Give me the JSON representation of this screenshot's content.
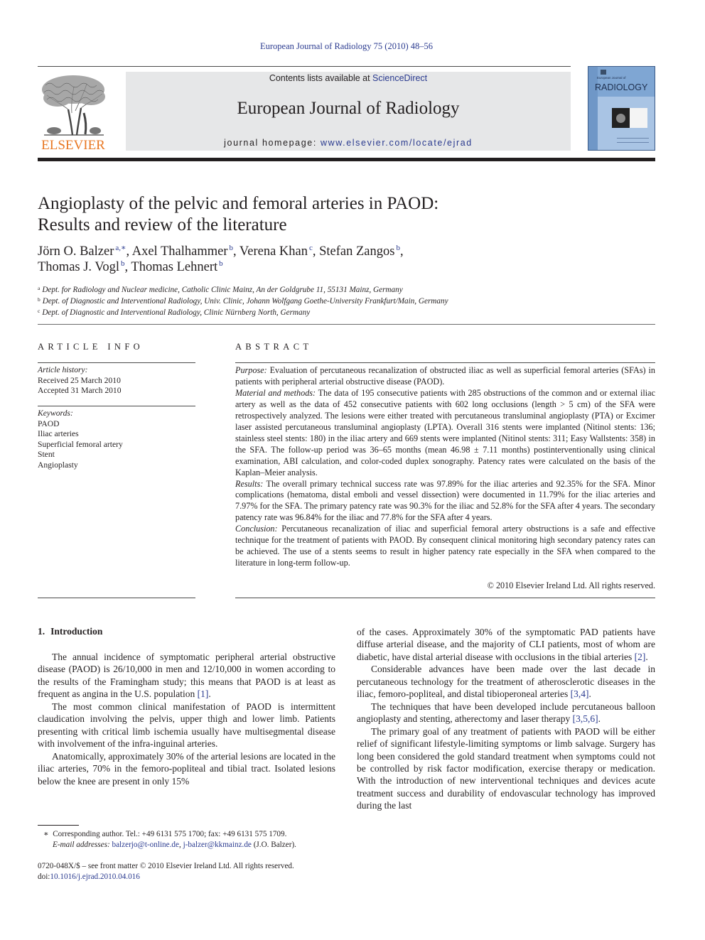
{
  "citation": "European Journal of Radiology 75 (2010) 48–56",
  "masthead": {
    "publisher_logo_text": "ELSEVIER",
    "contents_prefix": "Contents lists available at ",
    "contents_link": "ScienceDirect",
    "journal_title": "European Journal of Radiology",
    "homepage_prefix": "journal homepage: ",
    "homepage_link": "www.elsevier.com/locate/ejrad",
    "cover_small_title": "European Journal of",
    "cover_big_title": "RADIOLOGY",
    "colors": {
      "elsevier_orange": "#e87722",
      "link_blue": "#2a3a8f",
      "banner_gray": "#e6e7e8",
      "cover_blue": "#7fa6d3"
    }
  },
  "article": {
    "title_line1": "Angioplasty of the pelvic and femoral arteries in PAOD:",
    "title_line2": "Results and review of the literature",
    "authors": [
      {
        "name": "Jörn O. Balzer",
        "aff": "a,∗",
        "sep": ", "
      },
      {
        "name": "Axel Thalhammer",
        "aff": "b",
        "sep": ", "
      },
      {
        "name": "Verena Khan",
        "aff": "c",
        "sep": ", "
      },
      {
        "name": "Stefan Zangos",
        "aff": "b",
        "sep": ","
      },
      {
        "name": "Thomas J. Vogl",
        "aff": "b",
        "sep": ", "
      },
      {
        "name": "Thomas Lehnert",
        "aff": "b",
        "sep": ""
      }
    ],
    "affiliations": [
      {
        "mark": "a",
        "text": "Dept. for Radiology and Nuclear medicine, Catholic Clinic Mainz, An der Goldgrube 11, 55131 Mainz, Germany"
      },
      {
        "mark": "b",
        "text": "Dept. of Diagnostic and Interventional Radiology, Univ. Clinic, Johann Wolfgang Goethe-University Frankfurt/Main, Germany"
      },
      {
        "mark": "c",
        "text": "Dept. of Diagnostic and Interventional Radiology, Clinic Nürnberg North, Germany"
      }
    ]
  },
  "article_info": {
    "heading": "ARTICLE INFO",
    "history_label": "Article history:",
    "received": "Received 25 March 2010",
    "accepted": "Accepted 31 March 2010",
    "keywords_label": "Keywords:",
    "keywords": [
      "PAOD",
      "Iliac arteries",
      "Superficial femoral artery",
      "Stent",
      "Angioplasty"
    ]
  },
  "abstract": {
    "heading": "ABSTRACT",
    "sections": [
      {
        "label": "Purpose:",
        "text": " Evaluation of percutaneous recanalization of obstructed iliac as well as superficial femoral arteries (SFAs) in patients with peripheral arterial obstructive disease (PAOD)."
      },
      {
        "label": "Material and methods:",
        "text": " The data of 195 consecutive patients with 285 obstructions of the common and or external iliac artery as well as the data of 452 consecutive patients with 602 long occlusions (length > 5 cm) of the SFA were retrospectively analyzed. The lesions were either treated with percutaneous transluminal angioplasty (PTA) or Excimer laser assisted percutaneous transluminal angioplasty (LPTA). Overall 316 stents were implanted (Nitinol stents: 136; stainless steel stents: 180) in the iliac artery and 669 stents were implanted (Nitinol stents: 311; Easy Wallstents: 358) in the SFA. The follow-up period was 36–65 months (mean 46.98 ± 7.11 months) postinterventionally using clinical examination, ABI calculation, and color-coded duplex sonography. Patency rates were calculated on the basis of the Kaplan–Meier analysis."
      },
      {
        "label": "Results:",
        "text": " The overall primary technical success rate was 97.89% for the iliac arteries and 92.35% for the SFA. Minor complications (hematoma, distal emboli and vessel dissection) were documented in 11.79% for the iliac arteries and 7.97% for the SFA. The primary patency rate was 90.3% for the iliac and 52.8% for the SFA after 4 years. The secondary patency rate was 96.84% for the iliac and 77.8% for the SFA after 4 years."
      },
      {
        "label": "Conclusion:",
        "text": " Percutaneous recanalization of iliac and superficial femoral artery obstructions is a safe and effective technique for the treatment of patients with PAOD. By consequent clinical monitoring high secondary patency rates can be achieved. The use of a stents seems to result in higher patency rate especially in the SFA when compared to the literature in long-term follow-up."
      }
    ],
    "copyright": "© 2010 Elsevier Ireland Ltd. All rights reserved."
  },
  "body": {
    "section_number": "1.",
    "section_title": "Introduction",
    "left_paragraphs": [
      {
        "text": "The annual incidence of symptomatic peripheral arterial obstructive disease (PAOD) is 26/10,000 in men and 12/10,000 in women according to the results of the Framingham study; this means that PAOD is at least as frequent as angina in the U.S. population ",
        "ref": "[1]",
        "after": "."
      },
      {
        "text": "The most common clinical manifestation of PAOD is intermittent claudication involving the pelvis, upper thigh and lower limb. Patients presenting with critical limb ischemia usually have multisegmental disease with involvement of the infra-inguinal arteries.",
        "ref": "",
        "after": ""
      },
      {
        "text": "Anatomically, approximately 30% of the arterial lesions are located in the iliac arteries, 70% in the femoro-popliteal and tibial tract. Isolated lesions below the knee are present in only 15%",
        "ref": "",
        "after": ""
      }
    ],
    "right_paragraphs": [
      {
        "text": "of the cases. Approximately 30% of the symptomatic PAD patients have diffuse arterial disease, and the majority of CLI patients, most of whom are diabetic, have distal arterial disease with occlusions in the tibial arteries ",
        "ref": "[2]",
        "after": "."
      },
      {
        "text": "Considerable advances have been made over the last decade in percutaneous technology for the treatment of atherosclerotic diseases in the iliac, femoro-popliteal, and distal tibioperoneal arteries ",
        "ref": "[3,4]",
        "after": "."
      },
      {
        "text": "The techniques that have been developed include percutaneous balloon angioplasty and stenting, atherectomy and laser therapy ",
        "ref": "[3,5,6]",
        "after": "."
      },
      {
        "text": "The primary goal of any treatment of patients with PAOD will be either relief of significant lifestyle-limiting symptoms or limb salvage. Surgery has long been considered the gold standard treatment when symptoms could not be controlled by risk factor modification, exercise therapy or medication. With the introduction of new interventional techniques and devices acute treatment success and durability of endovascular technology has improved during the last",
        "ref": "",
        "after": ""
      }
    ]
  },
  "footnotes": {
    "star": "∗",
    "corresponding": "Corresponding author. Tel.: +49 6131 575 1700; fax: +49 6131 575 1709.",
    "email_label": "E-mail addresses:",
    "email1": "balzerjo@t-online.de",
    "email_sep": ", ",
    "email2": "j-balzer@kkmainz.de",
    "email_owner": " (J.O. Balzer).",
    "front_matter": "0720-048X/$ – see front matter © 2010 Elsevier Ireland Ltd. All rights reserved.",
    "doi_label": "doi:",
    "doi": "10.1016/j.ejrad.2010.04.016"
  }
}
